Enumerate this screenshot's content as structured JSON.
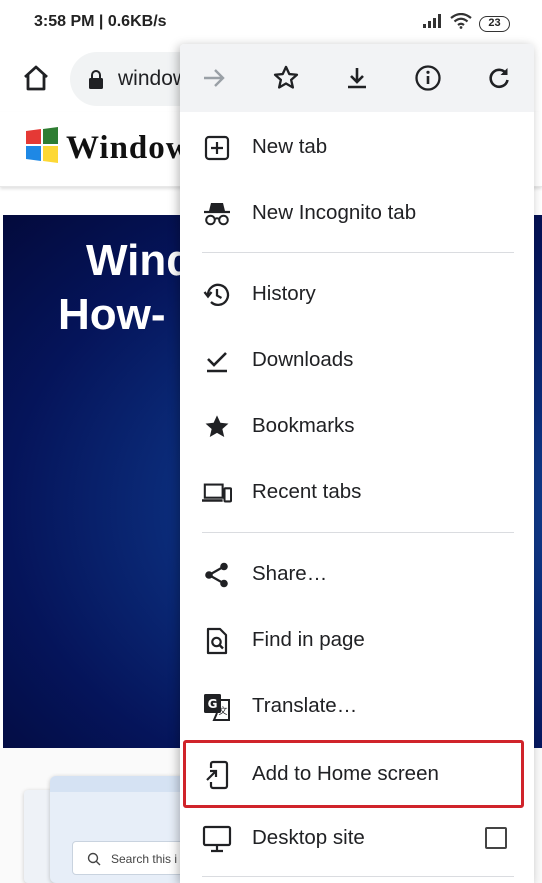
{
  "status_bar": {
    "time_and_speed": "3:58 PM | 0.6KB/s",
    "battery_level": "23",
    "icons": [
      "signal-icon",
      "wifi-icon",
      "battery-icon"
    ]
  },
  "toolbar": {
    "url_fragment": "window",
    "icons": [
      "home-icon",
      "lock-icon"
    ]
  },
  "page": {
    "logo_text": "Window",
    "hero_line1": "Wind",
    "hero_line2": "How-",
    "search_text": "Search this i"
  },
  "menu": {
    "top_icons": [
      "forward-icon",
      "bookmark-star-icon",
      "download-icon",
      "info-icon",
      "reload-icon"
    ],
    "items": [
      {
        "label": "New tab",
        "icon": "new-tab-icon"
      },
      {
        "label": "New Incognito tab",
        "icon": "incognito-icon"
      },
      {
        "label": "History",
        "icon": "history-icon"
      },
      {
        "label": "Downloads",
        "icon": "downloads-icon"
      },
      {
        "label": "Bookmarks",
        "icon": "bookmarks-star-icon"
      },
      {
        "label": "Recent tabs",
        "icon": "recent-tabs-icon"
      },
      {
        "label": "Share…",
        "icon": "share-icon"
      },
      {
        "label": "Find in page",
        "icon": "find-in-page-icon"
      },
      {
        "label": "Translate…",
        "icon": "translate-icon"
      },
      {
        "label": "Add to Home screen",
        "icon": "add-to-home-screen-icon"
      },
      {
        "label": "Desktop site",
        "icon": "desktop-icon"
      }
    ],
    "highlighted_item": "Add to Home screen",
    "highlight_color": "#d0232a",
    "desktop_site_checked": false
  }
}
